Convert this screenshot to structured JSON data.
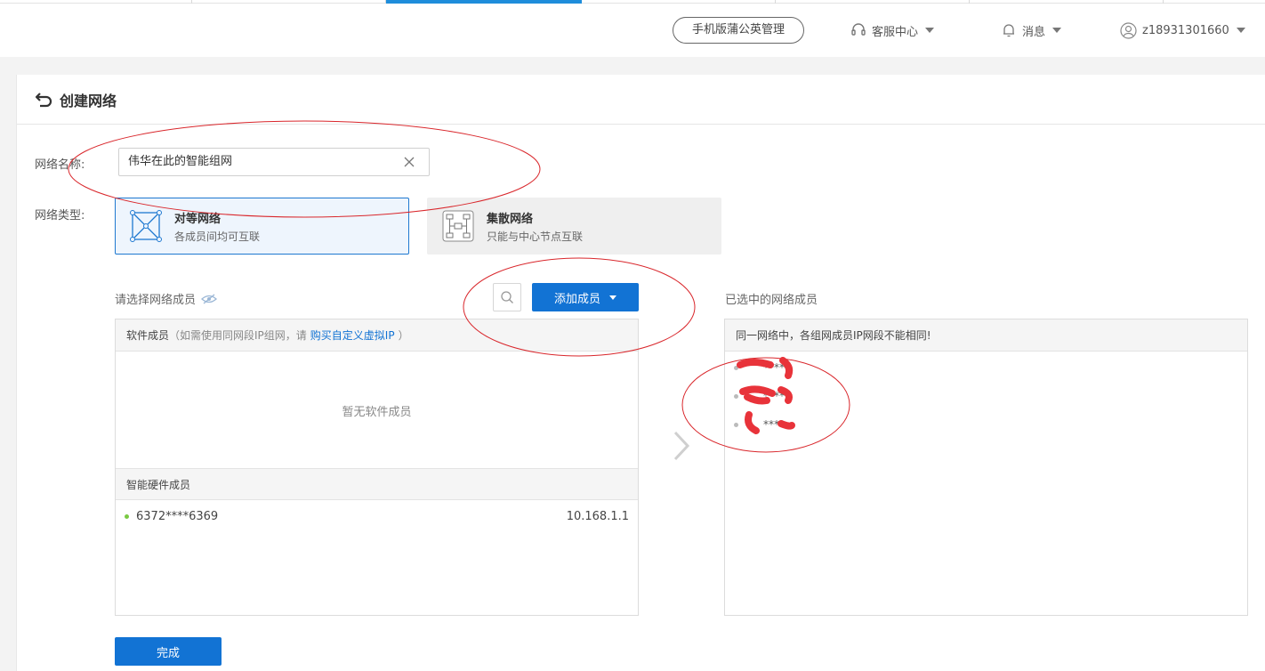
{
  "header": {
    "mobile_button": "手机版蒲公英管理",
    "support_label": "客服中心",
    "messages_label": "消息",
    "user_label": "z18931301660"
  },
  "page": {
    "title": "创建网络"
  },
  "form": {
    "name_label": "网络名称:",
    "name_value": "伟华在此的智能组网",
    "type_label": "网络类型:",
    "types": [
      {
        "title": "对等网络",
        "desc": "各成员间均可互联",
        "selected": true,
        "icon": "mesh-network-icon"
      },
      {
        "title": "集散网络",
        "desc": "只能与中心节点互联",
        "selected": false,
        "icon": "hub-network-icon"
      }
    ]
  },
  "members": {
    "choose_label": "请选择网络成员",
    "add_button": "添加成员",
    "software_header_main": "软件成员",
    "software_header_note_prefix": "（如需使用同网段IP组网，请",
    "software_header_link": "购买自定义虚拟IP",
    "software_header_note_suffix": "）",
    "software_empty": "暂无软件成员",
    "hardware_header": "智能硬件成员",
    "hardware_items": [
      {
        "id": "6372****6369",
        "ip": "10.168.1.1",
        "status_color": "#7ac943"
      }
    ]
  },
  "selected": {
    "label": "已选中的网络成员",
    "notice": "同一网络中，各组网成员IP网段不能相同!",
    "items": [
      {
        "id": "****0"
      },
      {
        "id": "****0"
      },
      {
        "id": "****"
      }
    ]
  },
  "footer": {
    "done_button": "完成"
  },
  "colors": {
    "primary": "#1273d4",
    "annotation_red": "#d9262b"
  }
}
